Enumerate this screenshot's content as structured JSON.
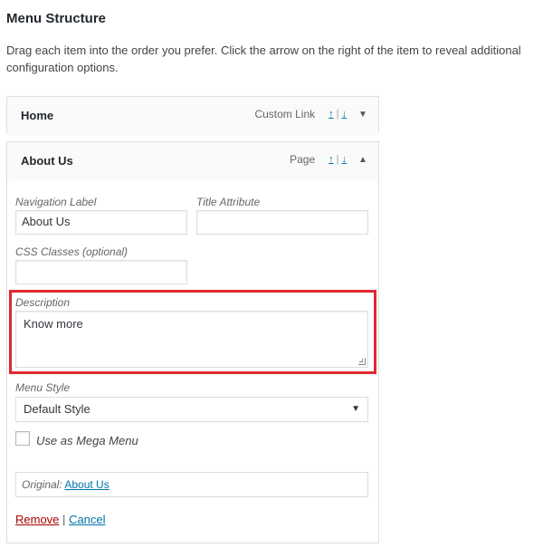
{
  "header": {
    "title": "Menu Structure",
    "instructions": "Drag each item into the order you prefer. Click the arrow on the right of the item to reveal additional configuration options."
  },
  "items": [
    {
      "title": "Home",
      "type": "Custom Link",
      "move_up": "↑",
      "move_separator": "|",
      "move_down": "↓",
      "toggle": "▼"
    },
    {
      "title": "About Us",
      "type": "Page",
      "move_up": "↑",
      "move_separator": "|",
      "move_down": "↓",
      "toggle": "▲"
    }
  ],
  "settings": {
    "nav_label": {
      "label": "Navigation Label",
      "value": "About Us"
    },
    "title_attr": {
      "label": "Title Attribute",
      "value": ""
    },
    "css_classes": {
      "label": "CSS Classes (optional)",
      "value": ""
    },
    "description": {
      "label": "Description",
      "value": "Know more"
    },
    "menu_style": {
      "label": "Menu Style",
      "selected": "Default Style",
      "arrow": "▼"
    },
    "mega_menu": {
      "label": "Use as Mega Menu",
      "checked": false
    },
    "original": {
      "label": "Original:",
      "link": "About Us"
    },
    "actions": {
      "remove": "Remove",
      "separator": "|",
      "cancel": "Cancel"
    }
  },
  "colors": {
    "highlight": "#e0282e",
    "link": "#0073aa",
    "remove": "#a00000"
  }
}
